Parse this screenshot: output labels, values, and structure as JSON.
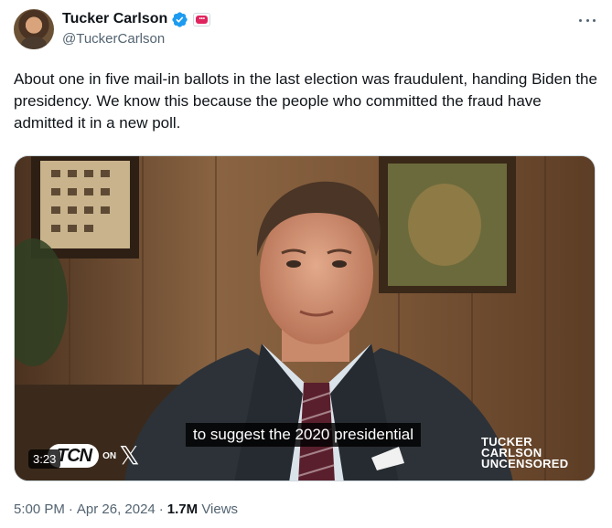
{
  "author": {
    "name": "Tucker Carlson",
    "handle": "@TuckerCarlson",
    "verified_color": "#1d9bf0",
    "affiliate_badge_icon": "affiliate-badge-icon"
  },
  "tweet": {
    "text": "About one in five mail-in ballots in the last election was fraudulent, handing Biden the presidency. We know this because the people who committed the fraud have admitted it in a new poll."
  },
  "media": {
    "caption": "to suggest the 2020 presidential",
    "duration": "3:23",
    "logo_text": "TCN",
    "logo_on": "ON",
    "logo_x": "𝕏",
    "brand_line1": "TUCKER",
    "brand_line2": "CARLSON",
    "brand_line3": "UNCENSORED"
  },
  "meta": {
    "time": "5:00 PM",
    "date": "Apr 26, 2024",
    "views_count": "1.7M",
    "views_label": "Views"
  },
  "colors": {
    "text": "#0f1419",
    "secondary": "#536471",
    "border": "#cfd9de"
  }
}
